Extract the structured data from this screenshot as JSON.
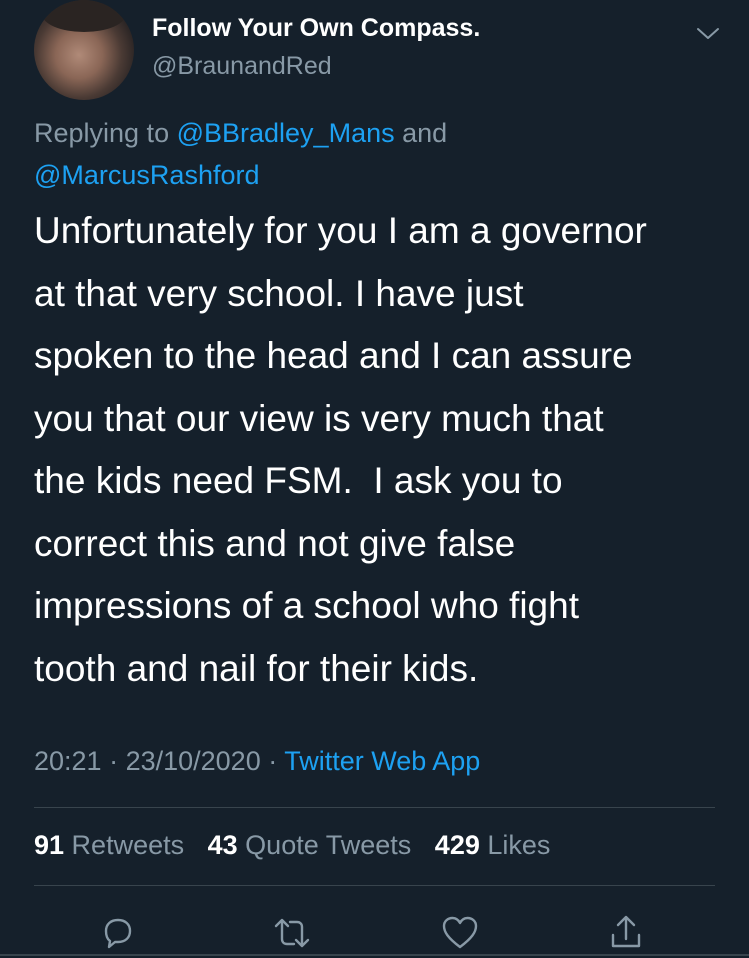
{
  "author": {
    "display_name": "Follow Your Own Compass.",
    "handle": "@BraunandRed"
  },
  "reply": {
    "prefix": "Replying to ",
    "mention1": "@BBradley_Mans",
    "joiner": " and",
    "mention2": "@MarcusRashford"
  },
  "tweet": {
    "lines": [
      "Unfortunately for you I am a governor",
      "at that very school. I have just",
      "spoken to the head and I can assure",
      "you that our view is very much that",
      "the kids need FSM.  I ask you to",
      "correct this and not give false",
      "impressions of a school who fight",
      "tooth and nail for their kids."
    ]
  },
  "meta": {
    "time": "20:21",
    "separator": " · ",
    "date": "23/10/2020",
    "source": "Twitter Web App"
  },
  "stats": {
    "retweets_count": "91",
    "retweets_label": " Retweets",
    "quotes_count": "43",
    "quotes_label": " Quote Tweets",
    "likes_count": "429",
    "likes_label": " Likes"
  },
  "colors": {
    "background": "#15202b",
    "secondary_text": "#8899a6",
    "accent": "#1da1f2",
    "divider": "#38444d"
  },
  "icons": {
    "caret": "chevron-down-icon",
    "reply": "reply-icon",
    "retweet": "retweet-icon",
    "like": "heart-icon",
    "share": "share-icon"
  }
}
